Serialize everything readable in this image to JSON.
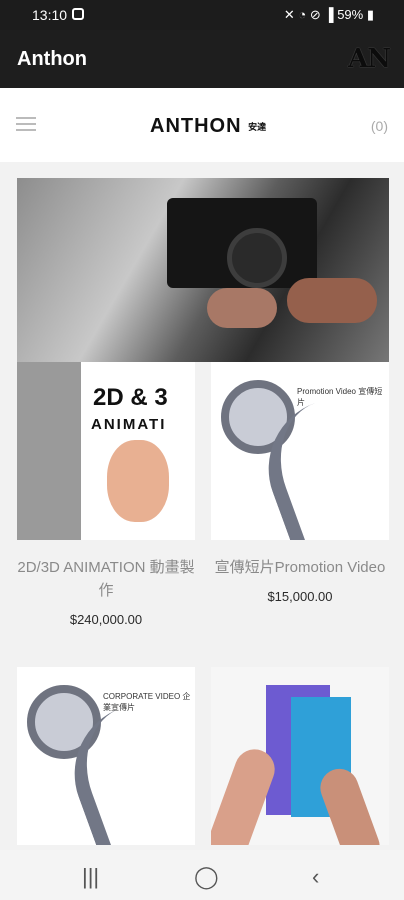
{
  "status": {
    "time": "13:10",
    "battery": "59%"
  },
  "appbar": {
    "title": "Anthon",
    "logo": "AN"
  },
  "header": {
    "brand": "ANTHON",
    "brand_sub": "安達",
    "cart": "(0)"
  },
  "products": [
    {
      "name": "2D/3D ANIMATION 動畫製作",
      "price": "$240,000.00",
      "image_text_1": "2D & 3",
      "image_text_2": "ANIMATI"
    },
    {
      "name": "宣傳短片Promotion Video",
      "price": "$15,000.00",
      "image_label": "Promotion Video\n宣傳短片"
    },
    {
      "name": "",
      "price": "",
      "image_label": "CORPORATE VIDEO\n企業宣傳片"
    },
    {
      "name": "",
      "price": ""
    }
  ],
  "icons": {
    "menu": "hamburger-icon",
    "recent": "recent-apps-icon",
    "home": "home-icon",
    "back": "back-icon"
  }
}
